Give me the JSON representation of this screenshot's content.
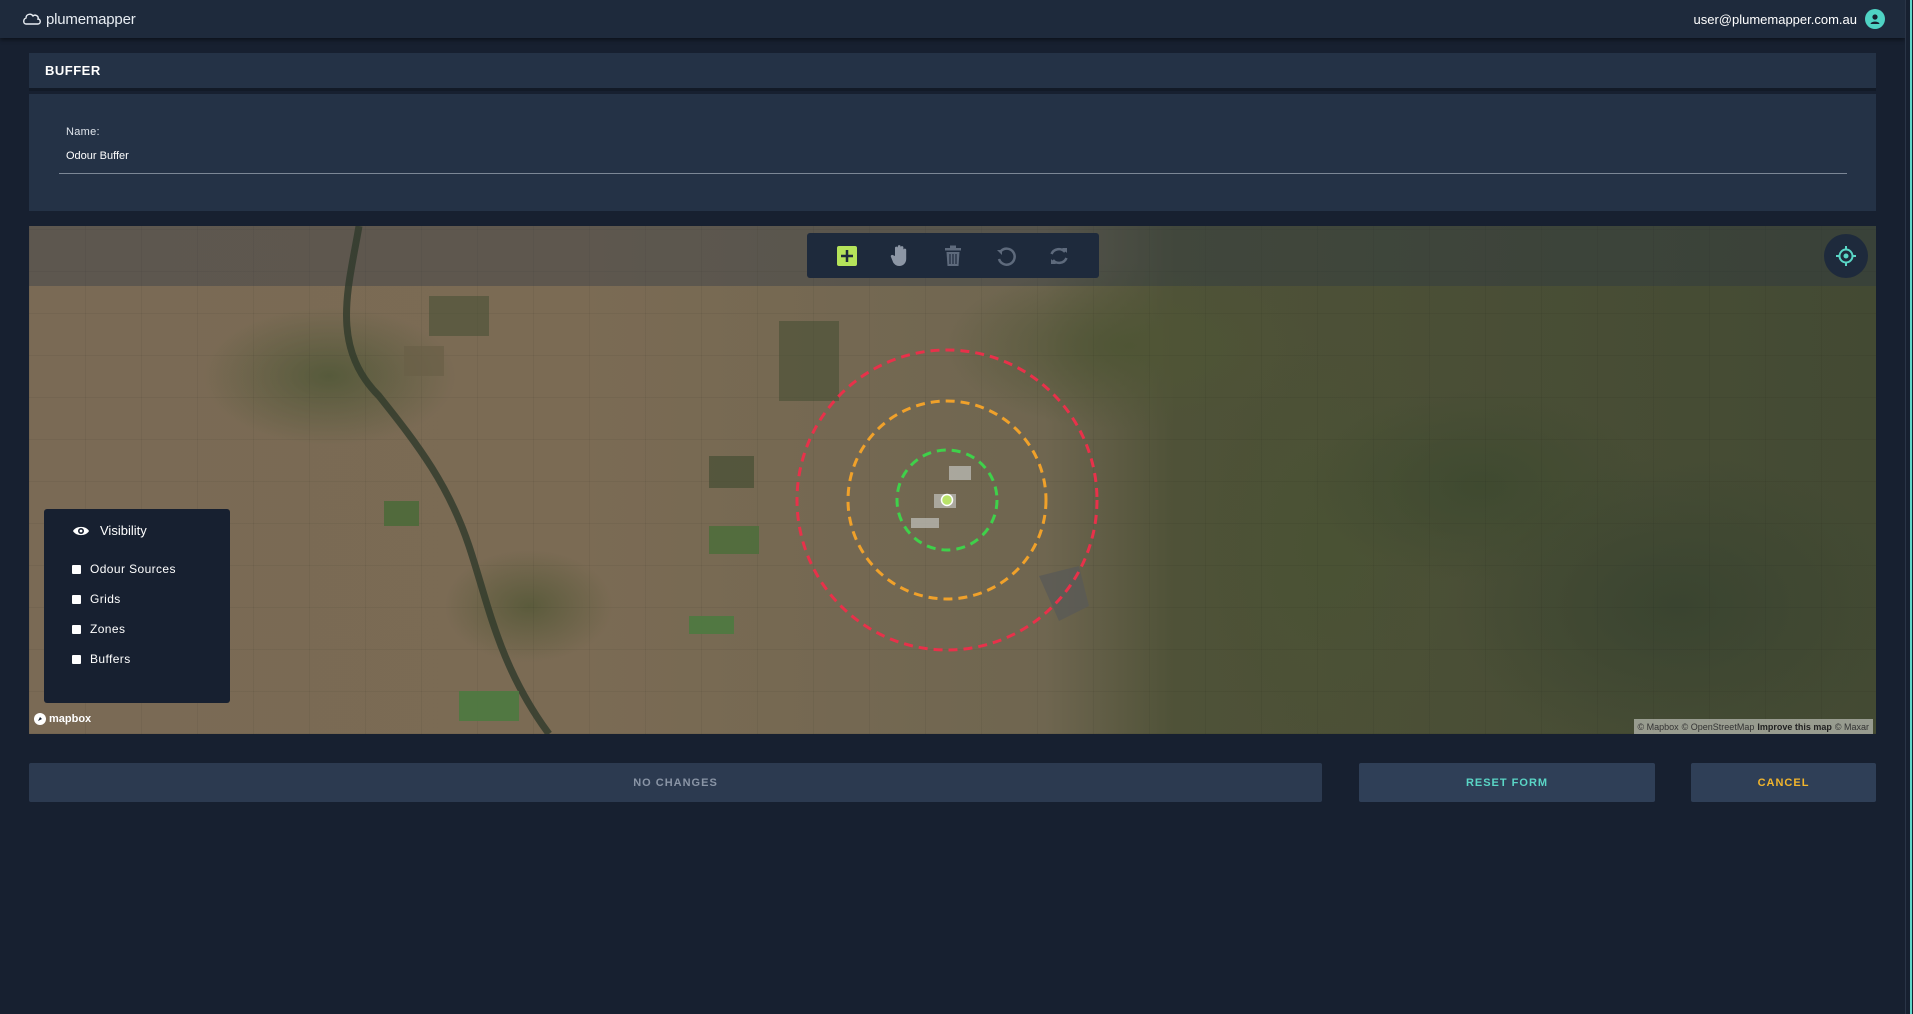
{
  "app": {
    "logo_text": "plumemapper",
    "user_email": "user@plumemapper.com.au"
  },
  "section": {
    "title": "BUFFER"
  },
  "form": {
    "name_label": "Name:",
    "name_value": "Odour Buffer"
  },
  "map": {
    "toolbar": {
      "icons": [
        "add-square-icon",
        "hand-pan-icon",
        "trash-icon",
        "undo-icon",
        "redo-icon"
      ]
    },
    "locate_icon": "crosshair-icon",
    "visibility": {
      "title": "Visibility",
      "items": [
        {
          "label": "Odour Sources",
          "checked": false
        },
        {
          "label": "Grids",
          "checked": false
        },
        {
          "label": "Zones",
          "checked": false
        },
        {
          "label": "Buffers",
          "checked": false
        }
      ]
    },
    "buffer_rings": [
      {
        "color": "#e8314a",
        "label": "outer"
      },
      {
        "color": "#f0a12a",
        "label": "middle"
      },
      {
        "color": "#3fd14a",
        "label": "inner"
      }
    ],
    "mapbox_logo": "mapbox",
    "attribution": {
      "mapbox": "© Mapbox",
      "osm": "© OpenStreetMap",
      "improve": "Improve this map",
      "maxar": "© Maxar"
    }
  },
  "actions": {
    "no_changes": "NO CHANGES",
    "reset": "RESET FORM",
    "cancel": "CANCEL"
  },
  "colors": {
    "background": "#172030",
    "panel": "#243246",
    "accent_teal": "#5ad6c6",
    "accent_yellow": "#f2b52c",
    "add_green": "#b5e35a"
  }
}
